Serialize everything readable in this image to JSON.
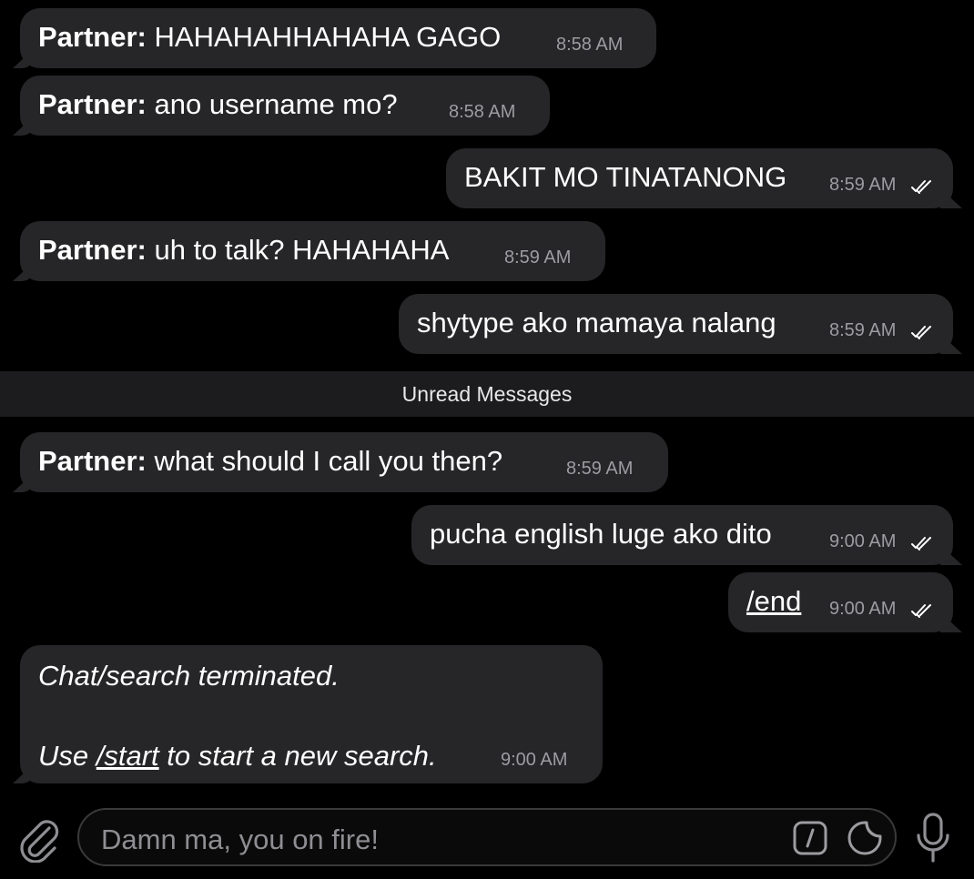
{
  "messages": [
    {
      "sender": "Partner:",
      "text": "HAHAHAHHAHAHA GAGO",
      "time": "8:58 AM"
    },
    {
      "sender": "Partner:",
      "text": "ano username mo?",
      "time": "8:58 AM"
    },
    {
      "text": "BAKIT MO TINATANONG",
      "time": "8:59 AM"
    },
    {
      "sender": "Partner:",
      "text": "uh to talk? HAHAHAHA",
      "time": "8:59 AM"
    },
    {
      "text": "shytype ako mamaya nalang",
      "time": "8:59 AM"
    },
    {
      "sender": "Partner:",
      "text": "what should I call you then?",
      "time": "8:59 AM"
    },
    {
      "text": "pucha english luge ako dito",
      "time": "9:00 AM"
    },
    {
      "text": "/end",
      "time": "9:00 AM"
    }
  ],
  "unread_divider": "Unread Messages",
  "system_message": {
    "line1": "Chat/search terminated.",
    "line2_prefix": "Use ",
    "line2_command": "/start",
    "line2_suffix": " to start a new search.",
    "time": "9:00 AM"
  },
  "composer": {
    "placeholder": "Damn ma, you on fire!",
    "icons": [
      "paperclip-icon",
      "bot-command-icon",
      "sticker-icon",
      "microphone-icon"
    ]
  },
  "colors": {
    "background": "#000000",
    "bubble": "#262628",
    "timestamp": "#9c9ca1",
    "divider": "#1c1c1e"
  }
}
